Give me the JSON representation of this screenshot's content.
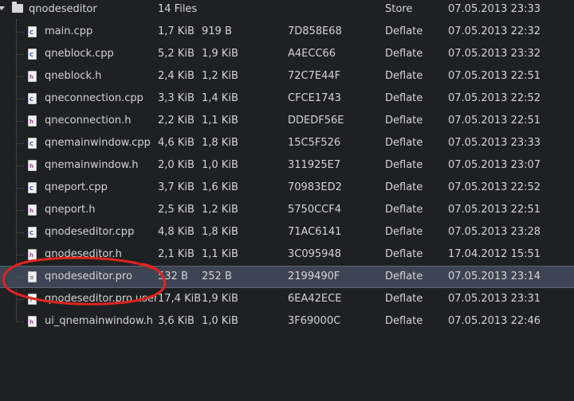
{
  "archive": {
    "root": {
      "name": "qnodeseditor",
      "size": "14 Files",
      "method": "Store",
      "date": "07.05.2013 23:33"
    },
    "files": [
      {
        "name": "main.cpp",
        "size": "1,7 KiB",
        "packed": "919 B",
        "crc": "7D858E68",
        "method": "Deflate",
        "date": "07.05.2013 22:32",
        "icon": "cpp-file-icon",
        "type": "cpp"
      },
      {
        "name": "qneblock.cpp",
        "size": "5,2 KiB",
        "packed": "1,9 KiB",
        "crc": "A4ECC66",
        "method": "Deflate",
        "date": "07.05.2013 23:32",
        "icon": "cpp-file-icon",
        "type": "cpp"
      },
      {
        "name": "qneblock.h",
        "size": "2,4 KiB",
        "packed": "1,2 KiB",
        "crc": "72C7E44F",
        "method": "Deflate",
        "date": "07.05.2013 22:51",
        "icon": "header-file-icon",
        "type": "h"
      },
      {
        "name": "qneconnection.cpp",
        "size": "3,3 KiB",
        "packed": "1,4 KiB",
        "crc": "CFCE1743",
        "method": "Deflate",
        "date": "07.05.2013 22:52",
        "icon": "cpp-file-icon",
        "type": "cpp"
      },
      {
        "name": "qneconnection.h",
        "size": "2,2 KiB",
        "packed": "1,1 KiB",
        "crc": "DDEDF56E",
        "method": "Deflate",
        "date": "07.05.2013 22:51",
        "icon": "header-file-icon",
        "type": "h"
      },
      {
        "name": "qnemainwindow.cpp",
        "size": "4,6 KiB",
        "packed": "1,8 KiB",
        "crc": "15C5F526",
        "method": "Deflate",
        "date": "07.05.2013 23:33",
        "icon": "cpp-file-icon",
        "type": "cpp"
      },
      {
        "name": "qnemainwindow.h",
        "size": "2,0 KiB",
        "packed": "1,0 KiB",
        "crc": "311925E7",
        "method": "Deflate",
        "date": "07.05.2013 23:07",
        "icon": "header-file-icon",
        "type": "h"
      },
      {
        "name": "qneport.cpp",
        "size": "3,7 KiB",
        "packed": "1,6 KiB",
        "crc": "70983ED2",
        "method": "Deflate",
        "date": "07.05.2013 22:52",
        "icon": "cpp-file-icon",
        "type": "cpp"
      },
      {
        "name": "qneport.h",
        "size": "2,5 KiB",
        "packed": "1,2 KiB",
        "crc": "5750CCF4",
        "method": "Deflate",
        "date": "07.05.2013 22:51",
        "icon": "header-file-icon",
        "type": "h"
      },
      {
        "name": "qnodeseditor.cpp",
        "size": "4,8 KiB",
        "packed": "1,8 KiB",
        "crc": "71AC6141",
        "method": "Deflate",
        "date": "07.05.2013 23:28",
        "icon": "cpp-file-icon",
        "type": "cpp"
      },
      {
        "name": "qnodeseditor.h",
        "size": "2,1 KiB",
        "packed": "1,1 KiB",
        "crc": "3C095948",
        "method": "Deflate",
        "date": "17.04.2012 15:51",
        "icon": "header-file-icon",
        "type": "h"
      },
      {
        "name": "qnodeseditor.pro",
        "size": "532 B",
        "packed": "252 B",
        "crc": "2199490F",
        "method": "Deflate",
        "date": "07.05.2013 23:14",
        "icon": "project-file-icon",
        "type": "pro",
        "selected": true
      },
      {
        "name": "qnodeseditor.pro.user",
        "size": "17,4 KiB",
        "packed": "1,9 KiB",
        "crc": "6EA42ECE",
        "method": "Deflate",
        "date": "07.05.2013 23:31",
        "icon": "unknown-file-icon",
        "type": "user"
      },
      {
        "name": "ui_qnemainwindow.h",
        "size": "3,6 KiB",
        "packed": "1,0 KiB",
        "crc": "3F69000C",
        "method": "Deflate",
        "date": "07.05.2013 22:46",
        "icon": "header-file-icon",
        "type": "h"
      }
    ]
  },
  "icon_marks": {
    "cpp": "C",
    "h": "h",
    "pro": "≡",
    "user": "?"
  },
  "colors": {
    "background": "#1f2023",
    "text": "#d4d4d4",
    "selection": "#3d4453",
    "annotation": "#e0241f"
  }
}
